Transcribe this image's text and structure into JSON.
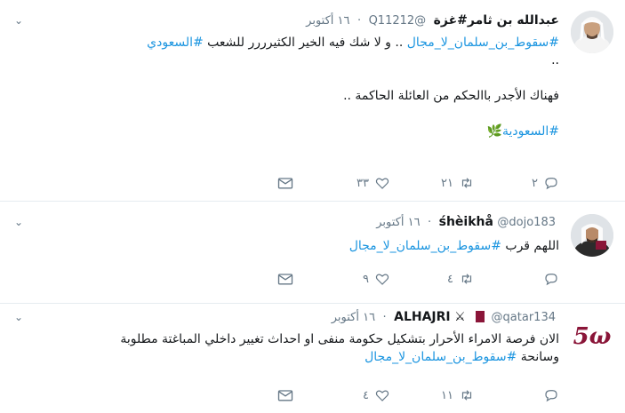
{
  "tweets": [
    {
      "name": "عبدالله بن ثامر#غزة",
      "handle": "@Q11212",
      "date": "١٦ أكتوبر",
      "lines": [
        {
          "pre": "",
          "tag": "#سقوط_بن_سلمان_لا_مجال",
          "post": " .. و لا شك فيه الخير الكثيرررر للشعب ",
          "tag2": "#السعودي"
        },
        {
          "text": ".."
        },
        {
          "text": ""
        },
        {
          "text": "فهناك الأجدر باالحكم من العائلة الحاكمة .."
        },
        {
          "text": ""
        },
        {
          "tag": "#السعودية",
          "emoji": "🌿"
        }
      ],
      "replies": "٢",
      "retweets": "٢١",
      "likes": "٣٣"
    },
    {
      "name": "śhèikhå",
      "handle": "@dojo183",
      "date": "١٦ أكتوبر",
      "lines": [
        {
          "pre": "اللهم قرب ",
          "tag": "#سقوط_بن_سلمان_لا_مجال"
        }
      ],
      "replies": "",
      "retweets": "٤",
      "likes": "٩"
    },
    {
      "name": "ALHAJRI",
      "handle": "@qatar134",
      "date": "١٦ أكتوبر",
      "lines": [
        {
          "text": "الان فرصة الامراء الأحرار بتشكيل حكومة منفى او احداث تغيير داخلي المباغتة مطلوبة"
        },
        {
          "pre": "وسانحة ",
          "tag": "#سقوط_بن_سلمان_لا_مجال"
        }
      ],
      "replies": "",
      "retweets": "١١",
      "likes": "٤"
    }
  ],
  "colors": {
    "accent": "#1b95e0",
    "muted": "#657786",
    "divider": "#e6ecf0"
  }
}
